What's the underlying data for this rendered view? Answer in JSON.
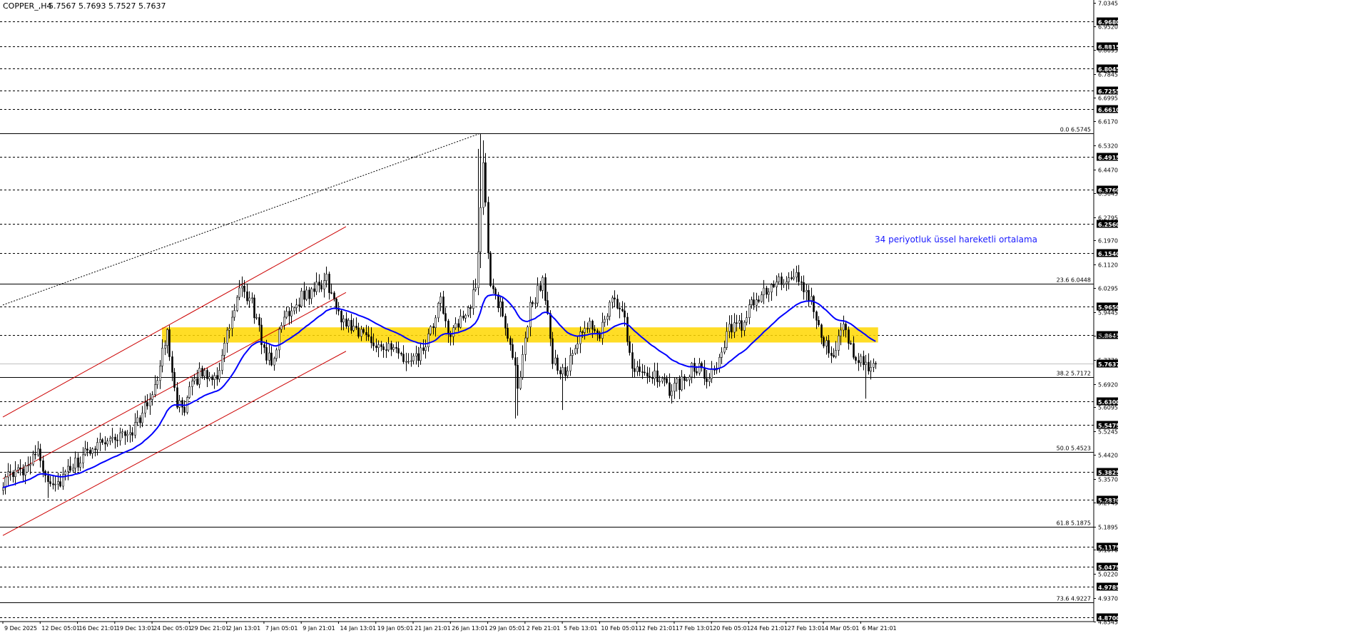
{
  "header": {
    "symbol": "COPPER_,H4",
    "quote": "5.7567 5.7693 5.7527 5.7637"
  },
  "annotation": {
    "text": "34 periyotluk üssel hareketli ortalama",
    "color": "#1a1aff"
  },
  "colors": {
    "background": "#ffffff",
    "bull_candle": "#ffffff",
    "bear_candle": "#000000",
    "ema": "#0000ff",
    "channel": "#cc0000",
    "zone": "#ffd700",
    "current_price_bg": "#000000"
  },
  "chart_data": {
    "type": "candlestick",
    "symbol": "COPPER_",
    "timeframe": "H4",
    "ylim": [
      4.8545,
      7.0345
    ],
    "y_ticks": [
      7.0345,
      6.952,
      6.8695,
      6.7845,
      6.6995,
      6.617,
      6.532,
      6.447,
      6.3645,
      6.2795,
      6.197,
      6.112,
      6.0295,
      5.9445,
      5.862,
      5.777,
      5.692,
      5.6095,
      5.5245,
      5.442,
      5.357,
      5.2745,
      5.1895,
      5.107,
      5.022,
      4.937,
      4.8545
    ],
    "y_tick_labels": [
      "7.0345",
      "6.9520",
      "6.8695",
      "6.7845",
      "6.6995",
      "6.6170",
      "6.5320",
      "6.4470",
      "6.3645",
      "6.2795",
      "6.1970",
      "6.1120",
      "6.0295",
      "5.9445",
      "5.8620",
      "5.7770",
      "5.6920",
      "5.6095",
      "5.5245",
      "5.4420",
      "5.3570",
      "5.2745",
      "5.1895",
      "5.1070",
      "5.0220",
      "4.9370",
      "4.8545"
    ],
    "x_labels": [
      "9 Dec 2025",
      "12 Dec 05:01",
      "16 Dec 21:01",
      "19 Dec 13:01",
      "24 Dec 05:01",
      "29 Dec 21:01",
      "2 Jan 13:01",
      "7 Jan 05:01",
      "9 Jan 21:01",
      "14 Jan 13:01",
      "19 Jan 05:01",
      "21 Jan 21:01",
      "26 Jan 13:01",
      "29 Jan 05:01",
      "2 Feb 21:01",
      "5 Feb 13:01",
      "10 Feb 05:01",
      "12 Feb 21:01",
      "17 Feb 13:01",
      "20 Feb 05:01",
      "24 Feb 21:01",
      "27 Feb 13:01",
      "4 Mar 05:01",
      "6 Mar 21:01"
    ],
    "x_label_bar_index": [
      0,
      15,
      30,
      45,
      60,
      75,
      90,
      105,
      120,
      135,
      150,
      165,
      180,
      195,
      210,
      225,
      240,
      255,
      270,
      285,
      300,
      315,
      330,
      345
    ],
    "bar_count": 352,
    "anchors_close": [
      [
        0,
        5.35
      ],
      [
        8,
        5.39
      ],
      [
        13,
        5.46
      ],
      [
        18,
        5.36
      ],
      [
        22,
        5.34
      ],
      [
        28,
        5.4
      ],
      [
        33,
        5.44
      ],
      [
        38,
        5.49
      ],
      [
        45,
        5.5
      ],
      [
        52,
        5.53
      ],
      [
        58,
        5.62
      ],
      [
        62,
        5.72
      ],
      [
        66,
        5.87
      ],
      [
        70,
        5.63
      ],
      [
        73,
        5.58
      ],
      [
        76,
        5.7
      ],
      [
        80,
        5.73
      ],
      [
        86,
        5.72
      ],
      [
        90,
        5.86
      ],
      [
        95,
        6.02
      ],
      [
        100,
        5.98
      ],
      [
        104,
        5.84
      ],
      [
        108,
        5.76
      ],
      [
        113,
        5.93
      ],
      [
        120,
        6.0
      ],
      [
        125,
        6.02
      ],
      [
        130,
        6.06
      ],
      [
        135,
        5.93
      ],
      [
        140,
        5.9
      ],
      [
        146,
        5.86
      ],
      [
        152,
        5.83
      ],
      [
        158,
        5.8
      ],
      [
        164,
        5.76
      ],
      [
        170,
        5.82
      ],
      [
        176,
        5.98
      ],
      [
        180,
        5.86
      ],
      [
        185,
        5.92
      ],
      [
        190,
        6.02
      ],
      [
        193,
        6.48
      ],
      [
        196,
        6.02
      ],
      [
        200,
        5.96
      ],
      [
        204,
        5.84
      ],
      [
        207,
        5.68
      ],
      [
        212,
        5.96
      ],
      [
        217,
        6.06
      ],
      [
        221,
        5.78
      ],
      [
        226,
        5.72
      ],
      [
        231,
        5.84
      ],
      [
        236,
        5.9
      ],
      [
        240,
        5.87
      ],
      [
        244,
        5.98
      ],
      [
        249,
        5.96
      ],
      [
        253,
        5.76
      ],
      [
        258,
        5.74
      ],
      [
        263,
        5.71
      ],
      [
        268,
        5.67
      ],
      [
        273,
        5.7
      ],
      [
        278,
        5.76
      ],
      [
        283,
        5.72
      ],
      [
        288,
        5.78
      ],
      [
        292,
        5.88
      ],
      [
        297,
        5.9
      ],
      [
        302,
        5.98
      ],
      [
        306,
        6.02
      ],
      [
        310,
        6.04
      ],
      [
        314,
        6.05
      ],
      [
        318,
        6.07
      ],
      [
        322,
        6.03
      ],
      [
        326,
        5.96
      ],
      [
        330,
        5.85
      ],
      [
        334,
        5.8
      ],
      [
        338,
        5.88
      ],
      [
        342,
        5.8
      ],
      [
        346,
        5.78
      ],
      [
        348,
        5.72
      ],
      [
        351,
        5.7637
      ]
    ],
    "special_bars": [
      {
        "index": 18,
        "low": 5.29
      },
      {
        "index": 191,
        "high": 6.52
      },
      {
        "index": 192,
        "high": 6.5745,
        "low": 6.1
      },
      {
        "index": 193,
        "high": 6.55
      },
      {
        "index": 194,
        "high": 6.42
      },
      {
        "index": 206,
        "low": 5.57
      },
      {
        "index": 207,
        "low": 5.58
      },
      {
        "index": 225,
        "low": 5.6
      },
      {
        "index": 347,
        "low": 5.64
      }
    ],
    "ema_period": 34,
    "fibonacci_levels": [
      {
        "level": "0.0",
        "price": 6.5745
      },
      {
        "level": "23.6",
        "price": 6.0448
      },
      {
        "level": "38.2",
        "price": 5.7172
      },
      {
        "level": "50.0",
        "price": 5.4523
      },
      {
        "level": "61.8",
        "price": 5.1875
      },
      {
        "level": "73.6",
        "price": 4.9227
      }
    ],
    "horizontal_levels": [
      6.968,
      6.8815,
      6.8045,
      6.7255,
      6.661,
      6.4915,
      6.376,
      6.256,
      6.154,
      5.965,
      5.8645,
      5.63,
      5.5475,
      5.3825,
      5.283,
      5.1175,
      5.0475,
      4.9785,
      4.87
    ],
    "horizontal_level_labels": [
      "6.9680",
      "6.8815",
      "6.8045",
      "6.7255",
      "6.6610",
      "6.4915",
      "6.3760",
      "6.2560",
      "6.1540",
      "5.9650",
      "5.8645",
      "5.6300",
      "5.5475",
      "5.3825",
      "5.2830",
      "5.1175",
      "5.0475",
      "4.9785",
      "4.8700"
    ],
    "current_price": 5.7637,
    "current_price_label": "5.7637",
    "support_resistance_zone": {
      "top": 5.8912,
      "bottom": 5.8378,
      "from_bar": 64,
      "to_bar": 352
    },
    "channel": {
      "upper": {
        "from": [
          0,
          5.575
        ],
        "to": [
          138,
          6.246
        ]
      },
      "middle": {
        "from": [
          0,
          5.358
        ],
        "to": [
          138,
          6.014
        ]
      },
      "lower": {
        "from": [
          0,
          5.158
        ],
        "to": [
          138,
          5.807
        ]
      }
    },
    "trend_line": {
      "from": [
        0,
        5.97
      ],
      "to": [
        192,
        6.5745
      ]
    }
  }
}
